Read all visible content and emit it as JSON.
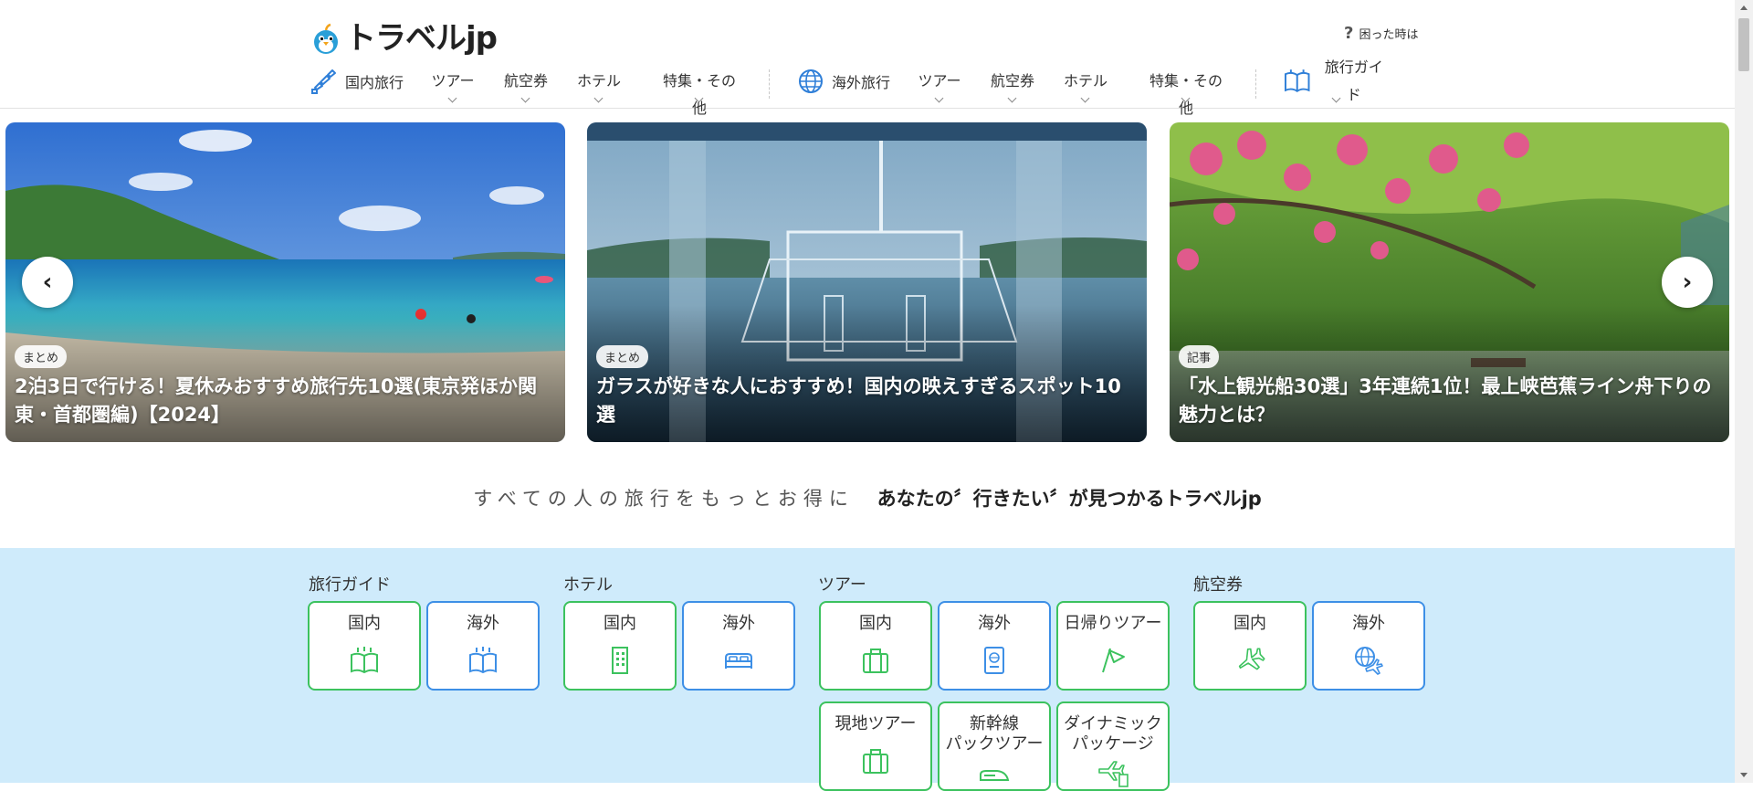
{
  "header": {
    "logo_text": "トラベルjp",
    "help_label": "困った時は"
  },
  "nav": {
    "domestic": {
      "label": "国内旅行",
      "items": [
        "ツアー",
        "航空券",
        "ホテル",
        "特集・その他"
      ]
    },
    "overseas": {
      "label": "海外旅行",
      "items": [
        "ツアー",
        "航空券",
        "ホテル",
        "特集・その他"
      ]
    },
    "guide": {
      "label": "旅行ガイド"
    }
  },
  "carousel": {
    "slides": [
      {
        "tag": "まとめ",
        "title": "2泊3日で行ける！夏休みおすすめ旅行先10選(東京発ほか関東・首都圏編)【2024】"
      },
      {
        "tag": "まとめ",
        "title": "ガラスが好きな人におすすめ！国内の映えすぎるスポット10選"
      },
      {
        "tag": "記事",
        "title": "「水上観光船30選」3年連続1位！最上峡芭蕉ライン舟下りの魅力とは？"
      }
    ],
    "prev_label": "‹",
    "next_label": "›"
  },
  "tagline": {
    "sub": "すべての人の旅行をもっとお得に",
    "main": "あなたの〞行きたい〞が見つかるトラベルjp"
  },
  "links": {
    "guide": {
      "title": "旅行ガイド",
      "buttons": [
        {
          "label": "国内",
          "icon": "book-icon",
          "color": "#3cc25e"
        },
        {
          "label": "海外",
          "icon": "book-icon",
          "color": "#3d8fe6"
        }
      ]
    },
    "hotel": {
      "title": "ホテル",
      "buttons": [
        {
          "label": "国内",
          "icon": "building-icon",
          "color": "#3cc25e"
        },
        {
          "label": "海外",
          "icon": "bed-icon",
          "color": "#3d8fe6"
        }
      ]
    },
    "tour": {
      "title": "ツアー",
      "buttons": [
        {
          "label": "国内",
          "icon": "suitcase-icon",
          "color": "#3cc25e"
        },
        {
          "label": "海外",
          "icon": "passport-icon",
          "color": "#3d8fe6"
        },
        {
          "label": "日帰りツアー",
          "icon": "flag-icon",
          "color": "#3cc25e"
        },
        {
          "label": "現地ツアー",
          "icon": "suitcase-icon",
          "color": "#3cc25e"
        },
        {
          "label": "新幹線パックツアー",
          "label_line1": "新幹線",
          "label_line2": "パックツアー",
          "icon": "shinkansen-icon",
          "color": "#3cc25e"
        },
        {
          "label": "ダイナミックパッケージ",
          "label_line1": "ダイナミック",
          "label_line2": "パッケージ",
          "icon": "plane-hotel-icon",
          "color": "#3cc25e"
        }
      ]
    },
    "air": {
      "title": "航空券",
      "buttons": [
        {
          "label": "国内",
          "icon": "plane-icon",
          "color": "#3cc25e"
        },
        {
          "label": "海外",
          "icon": "globe-plane-icon",
          "color": "#3d8fe6"
        }
      ]
    }
  },
  "colors": {
    "green": "#3cc25e",
    "blue": "#3d8fe6",
    "links_bg": "#cfebfb"
  }
}
